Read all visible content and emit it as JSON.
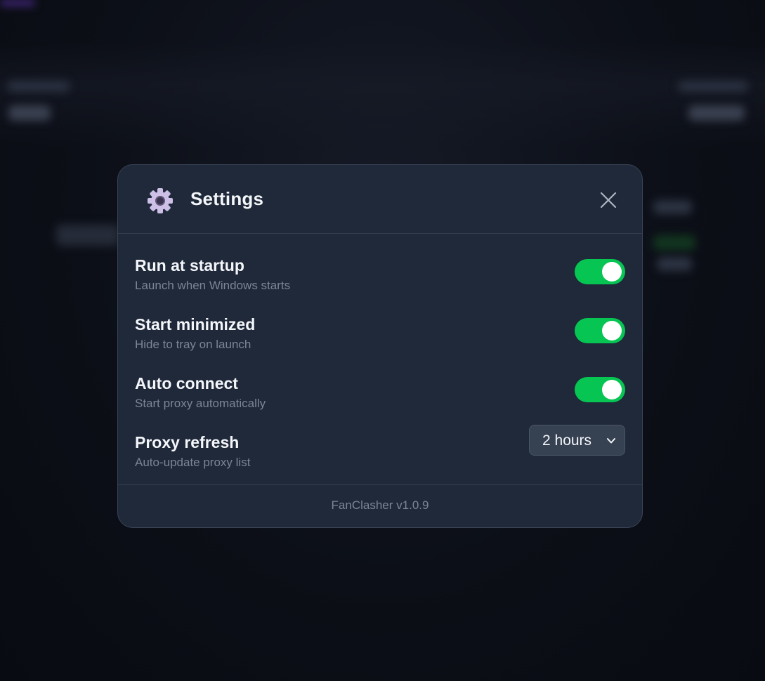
{
  "dialog": {
    "title": "Settings",
    "title_icon": "gear-icon",
    "close_icon": "close-icon",
    "accent_color": "#07c553"
  },
  "settings": [
    {
      "label": "Run at startup",
      "description": "Launch when Windows starts",
      "control": "toggle",
      "enabled": true
    },
    {
      "label": "Start minimized",
      "description": "Hide to tray on launch",
      "control": "toggle",
      "enabled": true
    },
    {
      "label": "Auto connect",
      "description": "Start proxy automatically",
      "control": "toggle",
      "enabled": true
    },
    {
      "label": "Proxy refresh",
      "description": "Auto-update proxy list",
      "control": "select",
      "value": "2 hours",
      "icon": "chevron-down-icon"
    }
  ],
  "footer": {
    "version": "FanClasher v1.0.9"
  }
}
